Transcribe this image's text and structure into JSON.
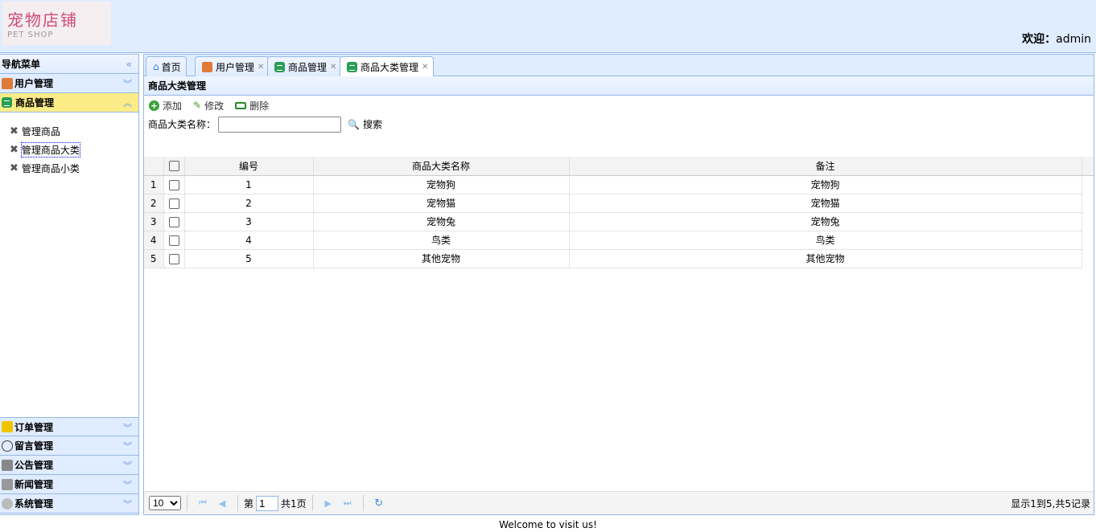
{
  "header": {
    "logo_cn": "宠物店铺",
    "logo_en": "PET SHOP",
    "welcome_label": "欢迎：",
    "user": "admin"
  },
  "sidebar": {
    "title": "导航菜单",
    "groups": [
      {
        "label": "用户管理",
        "icon": "users-icon"
      },
      {
        "label": "商品管理",
        "icon": "list-icon",
        "items": [
          "管理商品",
          "管理商品大类",
          "管理商品小类"
        ]
      },
      {
        "label": "订单管理",
        "icon": "folder-icon"
      },
      {
        "label": "留言管理",
        "icon": "comment-icon"
      },
      {
        "label": "公告管理",
        "icon": "notice-icon"
      },
      {
        "label": "新闻管理",
        "icon": "news-icon"
      },
      {
        "label": "系统管理",
        "icon": "gear-icon"
      }
    ]
  },
  "tabs": [
    {
      "label": "首页"
    },
    {
      "label": "用户管理"
    },
    {
      "label": "商品管理"
    },
    {
      "label": "商品大类管理"
    }
  ],
  "panel": {
    "title": "商品大类管理",
    "toolbar": {
      "add": "添加",
      "edit": "修改",
      "delete": "删除"
    },
    "search": {
      "label": "商品大类名称：",
      "value": "",
      "button": "搜索"
    },
    "columns": [
      "编号",
      "商品大类名称",
      "备注"
    ],
    "rows": [
      {
        "n": "1",
        "id": "1",
        "name": "宠物狗",
        "remark": "宠物狗"
      },
      {
        "n": "2",
        "id": "2",
        "name": "宠物猫",
        "remark": "宠物猫"
      },
      {
        "n": "3",
        "id": "3",
        "name": "宠物兔",
        "remark": "宠物兔"
      },
      {
        "n": "4",
        "id": "4",
        "name": "鸟类",
        "remark": "鸟类"
      },
      {
        "n": "5",
        "id": "5",
        "name": "其他宠物",
        "remark": "其他宠物"
      }
    ],
    "pager": {
      "page_size": "10",
      "page_prefix": "第",
      "page": "1",
      "total_pages": "共1页",
      "info": "显示1到5,共5记录"
    }
  },
  "footer": "Welcome to visit us!"
}
